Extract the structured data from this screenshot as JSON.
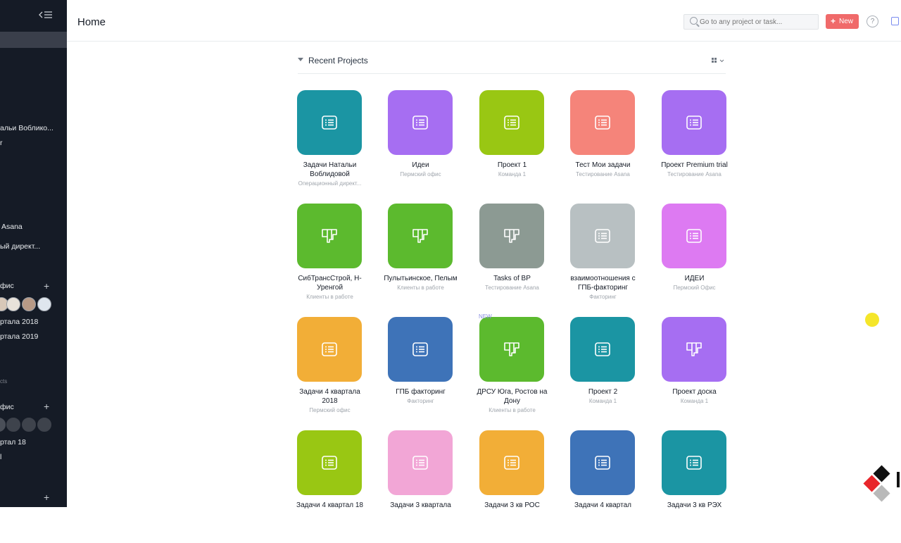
{
  "header": {
    "title": "Home",
    "search_placeholder": "Go to any project or task...",
    "new_label": "New",
    "help_label": "?"
  },
  "sidebar": {
    "items": [
      {
        "label": "альи Воблико..."
      },
      {
        "label": "r"
      },
      {
        "label": "Asana"
      },
      {
        "label": "ый директ..."
      },
      {
        "label": "фис"
      },
      {
        "label": "ртала 2018"
      },
      {
        "label": "ртала 2019"
      },
      {
        "label": "cts"
      },
      {
        "label": "фис"
      },
      {
        "label": "ртал 18"
      },
      {
        "label": "l"
      }
    ]
  },
  "section": {
    "title": "Recent Projects"
  },
  "projects": [
    {
      "name": "Задачи Натальи Воблидовой",
      "team": "Операционный директ...",
      "color": "#1b95a3",
      "icon": "list-icon"
    },
    {
      "name": "Идеи",
      "team": "Пермский офис",
      "color": "#a66ef2",
      "icon": "list-icon"
    },
    {
      "name": "Проект 1",
      "team": "Команда 1",
      "color": "#99c713",
      "icon": "list-icon"
    },
    {
      "name": "Тест Мои задачи",
      "team": "Тестирование Asana",
      "color": "#f5847a",
      "icon": "list-icon"
    },
    {
      "name": "Проект Premium trial",
      "team": "Тестирование Asana",
      "color": "#a66ef2",
      "icon": "list-icon"
    },
    {
      "name": "СибТрансСтрой, Н-Уренгой",
      "team": "Клиенты в работе",
      "color": "#5cba2e",
      "icon": "board-icon"
    },
    {
      "name": "Пулытьинское, Пелым",
      "team": "Клиенты в работе",
      "color": "#5cba2e",
      "icon": "board-icon"
    },
    {
      "name": "Tasks of BP",
      "team": "Тестирование Asana",
      "color": "#8c9a93",
      "icon": "board-icon"
    },
    {
      "name": "взаимоотношения с ГПБ-факторинг",
      "team": "Факторинг",
      "color": "#b8c0c2",
      "icon": "list-icon"
    },
    {
      "name": "ИДЕИ",
      "team": "Пермский Офис",
      "color": "#dd7af2",
      "icon": "list-icon"
    },
    {
      "name": "Задачи 4 квартала 2018",
      "team": "Пермский офис",
      "color": "#f2ae37",
      "icon": "list-icon"
    },
    {
      "name": "ГПБ факторинг",
      "team": "Факторинг",
      "color": "#3e73b8",
      "icon": "list-icon"
    },
    {
      "name": "ДРСУ Юга, Ростов на Дону",
      "team": "Клиенты в работе",
      "color": "#5cba2e",
      "icon": "board-icon",
      "badge": "NEW"
    },
    {
      "name": "Проект 2",
      "team": "Команда 1",
      "color": "#1b95a3",
      "icon": "list-icon"
    },
    {
      "name": "Проект доска",
      "team": "Команда 1",
      "color": "#a66ef2",
      "icon": "board-icon"
    },
    {
      "name": "Задачи 4 квартал 18",
      "team": "",
      "color": "#99c713",
      "icon": "list-icon"
    },
    {
      "name": "Задачи 3 квартала",
      "team": "",
      "color": "#f2a6d6",
      "icon": "list-icon"
    },
    {
      "name": "Задачи 3 кв РОС",
      "team": "",
      "color": "#f2ae37",
      "icon": "list-icon"
    },
    {
      "name": "Задачи 4 квартал",
      "team": "",
      "color": "#3e73b8",
      "icon": "list-icon"
    },
    {
      "name": "Задачи 3 кв РЭХ",
      "team": "",
      "color": "#1b95a3",
      "icon": "list-icon"
    }
  ]
}
